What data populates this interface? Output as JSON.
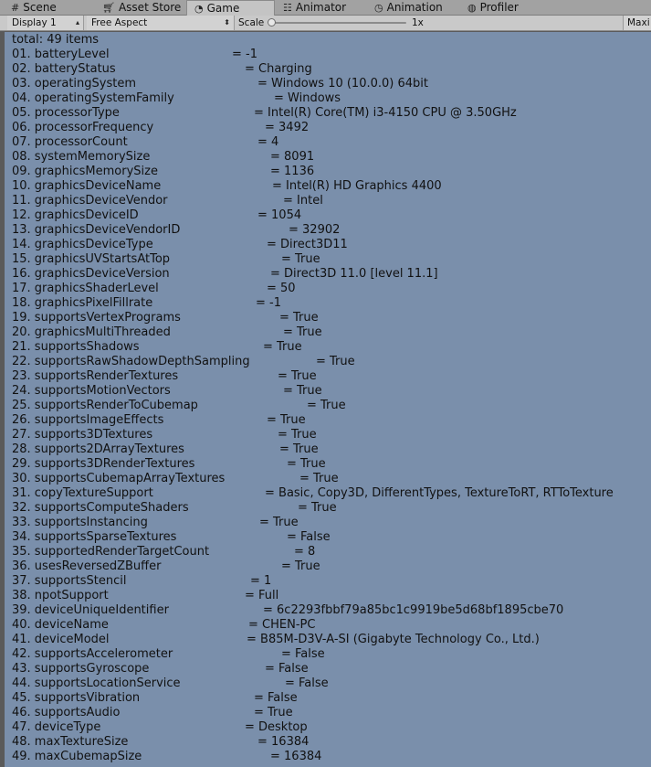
{
  "tabs": [
    {
      "label": "Scene",
      "icon": "grid-icon"
    },
    {
      "label": "Asset Store",
      "icon": "cart-icon"
    },
    {
      "label": "Game",
      "icon": "pacman-icon",
      "active": true
    },
    {
      "label": "Animator",
      "icon": "nodes-icon"
    },
    {
      "label": "Animation",
      "icon": "clock-icon"
    },
    {
      "label": "Profiler",
      "icon": "gauge-icon"
    }
  ],
  "toolbar": {
    "display": "Display 1",
    "aspect": "Free Aspect",
    "scale_label": "Scale",
    "scale_value": "1x",
    "maximize": "Maxi"
  },
  "info": {
    "total": "total: 49 items",
    "rows": [
      {
        "key": "01. batteryLevel",
        "value": "= -1"
      },
      {
        "key": "02. batteryStatus",
        "value": "= Charging"
      },
      {
        "key": "03. operatingSystem",
        "value": "= Windows 10  (10.0.0) 64bit"
      },
      {
        "key": "04. operatingSystemFamily",
        "value": "= Windows"
      },
      {
        "key": "05. processorType",
        "value": "= Intel(R) Core(TM) i3-4150 CPU @ 3.50GHz"
      },
      {
        "key": "06. processorFrequency",
        "value": "= 3492"
      },
      {
        "key": "07. processorCount",
        "value": "= 4"
      },
      {
        "key": "08. systemMemorySize",
        "value": "= 8091"
      },
      {
        "key": "09. graphicsMemorySize",
        "value": "= 1136"
      },
      {
        "key": "10. graphicsDeviceName",
        "value": "= Intel(R) HD Graphics 4400"
      },
      {
        "key": "11. graphicsDeviceVendor",
        "value": "= Intel"
      },
      {
        "key": "12. graphicsDeviceID",
        "value": "= 1054"
      },
      {
        "key": "13. graphicsDeviceVendorID",
        "value": "= 32902"
      },
      {
        "key": "14. graphicsDeviceType",
        "value": "= Direct3D11"
      },
      {
        "key": "15. graphicsUVStartsAtTop",
        "value": "= True"
      },
      {
        "key": "16. graphicsDeviceVersion",
        "value": "= Direct3D 11.0 [level 11.1]"
      },
      {
        "key": "17. graphicsShaderLevel",
        "value": "= 50"
      },
      {
        "key": "18. graphicsPixelFillrate",
        "value": "= -1"
      },
      {
        "key": "19. supportsVertexPrograms",
        "value": "= True"
      },
      {
        "key": "20. graphicsMultiThreaded",
        "value": "= True"
      },
      {
        "key": "21. supportsShadows",
        "value": "= True"
      },
      {
        "key": "22. supportsRawShadowDepthSampling",
        "value": "= True"
      },
      {
        "key": "23. supportsRenderTextures",
        "value": "= True"
      },
      {
        "key": "24. supportsMotionVectors",
        "value": "= True"
      },
      {
        "key": "25. supportsRenderToCubemap",
        "value": "= True"
      },
      {
        "key": "26. supportsImageEffects",
        "value": "= True"
      },
      {
        "key": "27. supports3DTextures",
        "value": "= True"
      },
      {
        "key": "28. supports2DArrayTextures",
        "value": "= True"
      },
      {
        "key": "29. supports3DRenderTextures",
        "value": "= True"
      },
      {
        "key": "30. supportsCubemapArrayTextures",
        "value": "= True"
      },
      {
        "key": "31. copyTextureSupport",
        "value": "= Basic, Copy3D, DifferentTypes, TextureToRT, RTToTexture"
      },
      {
        "key": "32. supportsComputeShaders",
        "value": "= True"
      },
      {
        "key": "33. supportsInstancing",
        "value": "= True"
      },
      {
        "key": "34. supportsSparseTextures",
        "value": "= False"
      },
      {
        "key": "35. supportedRenderTargetCount",
        "value": "= 8"
      },
      {
        "key": "36. usesReversedZBuffer",
        "value": "= True"
      },
      {
        "key": "37. supportsStencil",
        "value": "= 1"
      },
      {
        "key": "38. npotSupport",
        "value": "= Full"
      },
      {
        "key": "39. deviceUniqueIdentifier",
        "value": "= 6c2293fbbf79a85bc1c9919be5d68bf1895cbe70"
      },
      {
        "key": "40. deviceName",
        "value": "= CHEN-PC"
      },
      {
        "key": "41. deviceModel",
        "value": "= B85M-D3V-A-SI (Gigabyte Technology Co., Ltd.)"
      },
      {
        "key": "42. supportsAccelerometer",
        "value": "= False"
      },
      {
        "key": "43. supportsGyroscope",
        "value": "= False"
      },
      {
        "key": "44. supportsLocationService",
        "value": "= False"
      },
      {
        "key": "45. supportsVibration",
        "value": "= False"
      },
      {
        "key": "46. supportsAudio",
        "value": "= True"
      },
      {
        "key": "47. deviceType",
        "value": "= Desktop"
      },
      {
        "key": "48. maxTextureSize",
        "value": "= 16384"
      },
      {
        "key": "49. maxCubemapSize",
        "value": "= 16384"
      }
    ]
  }
}
